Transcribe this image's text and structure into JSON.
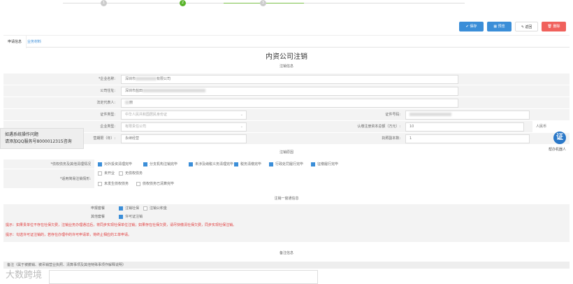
{
  "steps": [
    "1",
    "2",
    "3"
  ],
  "toolbar": {
    "save": "✔ 保存",
    "preview": "▦ 预览",
    "back": "↰ 返回",
    "delete": "🗑 删除"
  },
  "tabs": [
    "申请信息",
    "业务材料"
  ],
  "page_title": "内资公司注销",
  "sections": {
    "cancel_info": "注销信息",
    "reason": "注销原因",
    "one_window": "注销一窗通信息",
    "remark": "备注信息"
  },
  "form": {
    "company_name": {
      "label": "*企业名称:",
      "value_prefix": "深圳市",
      "value_suffix": "有限公司"
    },
    "address": {
      "label": "公司住址:",
      "value_prefix": "深圳市盐田"
    },
    "legal_rep": {
      "label": "法定代表人:",
      "value_suffix": "丽"
    },
    "id_type": {
      "label": "证件类型:",
      "value": "中华人民共和国居民身份证"
    },
    "id_number": {
      "label": "证件号码:"
    },
    "company_type": {
      "label": "企业类型:",
      "value": "有限责任公司"
    },
    "capital": {
      "label": "认缴注册资本总额（万元）:",
      "value": "10",
      "unit": "人民币"
    },
    "term": {
      "label": "营期限（年）:",
      "value": "永续经营"
    },
    "license_copies": {
      "label": "执照副本数:",
      "value": "1"
    }
  },
  "reason": {
    "debts_label": "*债权债务及其他清理情况",
    "debts_options": [
      "对外投资清理完毕",
      "分支机构注销完毕",
      "未涉及纳税义务清理完毕",
      "税务清缴完毕",
      "行政处罚履行完毕",
      "征缴履行完毕"
    ],
    "simple_label": "*适用简易注销情形:",
    "simple_options": [
      "未开业",
      "无债权债务",
      "未发生债权债务",
      "债权债务已清算完毕"
    ]
  },
  "one_window": {
    "declare_label": "申报套餐",
    "declare_options": [
      "注销社保",
      "注销公积金"
    ],
    "other_label": "其他套餐",
    "other_options": [
      "许可证注销"
    ],
    "tips": [
      "提示：如果贵单位不存在社保欠费，注销业务办理通过后，将同步实现社保单位注销；如果存在社保欠费，请尽快缴清社保欠费，同步实现社保注销。",
      "提示：勾选许可证注销的，若存在办理中的许可申请单，将终止相应的工单申请。"
    ]
  },
  "remark_label": "备注（属于被撤销、被吊销营业执照、清算事项及其他特殊事项作解释说明）",
  "help_popup": [
    "如遇系统操作问题",
    "请添加QQ服务号800001231​5咨询"
  ],
  "robot": {
    "icon_text": "证",
    "label": "帮办机器人"
  },
  "watermark": "大数跨境",
  "colors": {
    "primary": "#3b8ed8",
    "danger": "#f0615c",
    "step_active": "#58b32a"
  }
}
